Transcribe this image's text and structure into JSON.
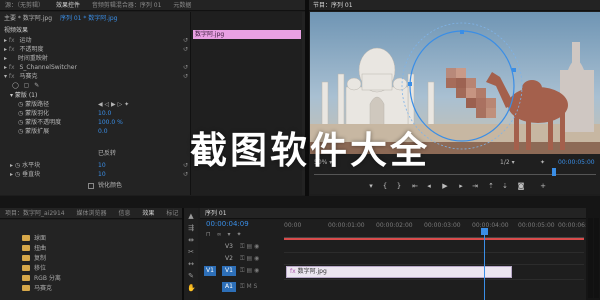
{
  "top_tabs": [
    "源：（无剪辑）",
    "效果控件",
    "音频剪辑混合器：序列 01",
    "元数据"
  ],
  "effects_panel": {
    "breadcrumb": "主要 * 数字阿.jpg",
    "sequence_link": "序列 01 * 数字阿.jpg",
    "clip_label": "数字阿.jpg",
    "section_video": "视频效果",
    "rows": [
      {
        "icon": "fx",
        "label": "运动"
      },
      {
        "icon": "fx",
        "label": "不透明度"
      },
      {
        "icon": "",
        "label": "时间重映射"
      },
      {
        "icon": "fx",
        "label": "S_ChannelSwitcher"
      },
      {
        "icon": "fx",
        "label": "马赛克"
      }
    ],
    "mask_label": "蒙版 (1)",
    "mask_props": [
      {
        "label": "蒙版路径",
        "value": ""
      },
      {
        "label": "蒙版羽化",
        "value": "10.0"
      },
      {
        "label": "蒙版不透明度",
        "value": "100.0 %"
      },
      {
        "label": "蒙版扩展",
        "value": "0.0"
      }
    ],
    "inverted": "已反转",
    "h_blocks_label": "水平块",
    "h_blocks_value": "10",
    "v_blocks_label": "垂直块",
    "v_blocks_value": "10",
    "sharp_colors": "锐化颜色"
  },
  "program": {
    "title": "节目：序列 01",
    "zoom": "50%",
    "quality": "1/2",
    "timecode": "00:00:05:00"
  },
  "project": {
    "tabs": [
      "项目：数字阿_ai2914",
      "媒体浏览器",
      "信息",
      "效果",
      "标记"
    ],
    "items": [
      "球面",
      "扭曲",
      "复制",
      "移位",
      "RGB 分离",
      "马赛克"
    ]
  },
  "timeline": {
    "tab": "序列 01",
    "timecode": "00:00:04:09",
    "ruler": [
      "00:00",
      "00:00:01:00",
      "00:00:02:00",
      "00:00:03:00",
      "00:00:04:00",
      "00:00:05:00",
      "00:00:06:00"
    ],
    "tracks": [
      "V3",
      "V2",
      "V1",
      "A1"
    ],
    "clip_label": "数字阿.jpg"
  },
  "watermark": "截图软件大全",
  "colors": {
    "accent_blue": "#2d8ceb",
    "clip_pink": "#e9a0e3",
    "timeline_red": "#d84b4b",
    "playhead": "#3a8ee6"
  }
}
